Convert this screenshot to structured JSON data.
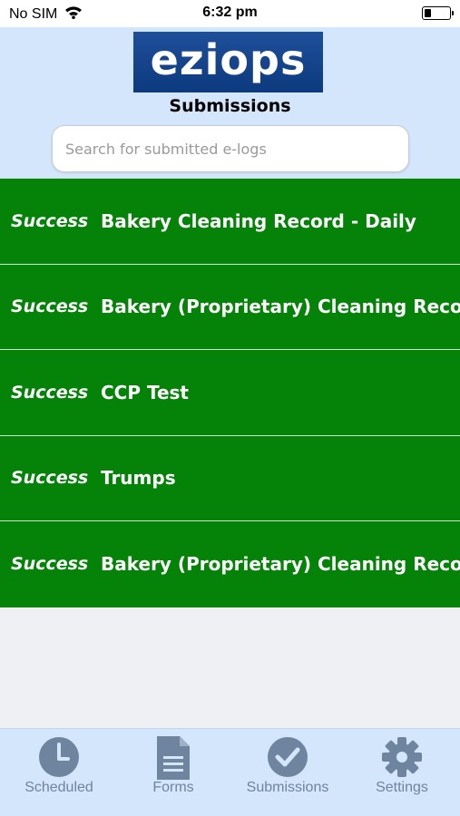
{
  "status_bar": {
    "carrier": "No SIM",
    "time": "6:32 pm",
    "battery_level": 0.25
  },
  "header": {
    "logo_text": "eziops",
    "title": "Submissions"
  },
  "search": {
    "placeholder": "Search for submitted e-logs",
    "value": ""
  },
  "submissions": [
    {
      "status": "Success",
      "title": "Bakery Cleaning Record - Daily"
    },
    {
      "status": "Success",
      "title": "Bakery (Proprietary) Cleaning Record"
    },
    {
      "status": "Success",
      "title": "CCP Test"
    },
    {
      "status": "Success",
      "title": "Trumps"
    },
    {
      "status": "Success",
      "title": "Bakery (Proprietary) Cleaning Record"
    }
  ],
  "tabs": [
    {
      "label": "Scheduled",
      "icon": "clock-icon"
    },
    {
      "label": "Forms",
      "icon": "document-icon"
    },
    {
      "label": "Submissions",
      "icon": "checkmark-circle-icon"
    },
    {
      "label": "Settings",
      "icon": "gear-icon"
    }
  ],
  "colors": {
    "success_row": "#058208",
    "header_bg": "#d3e6fb",
    "logo_bg": "#0d3a7e",
    "tab_icon": "#6f849e"
  }
}
